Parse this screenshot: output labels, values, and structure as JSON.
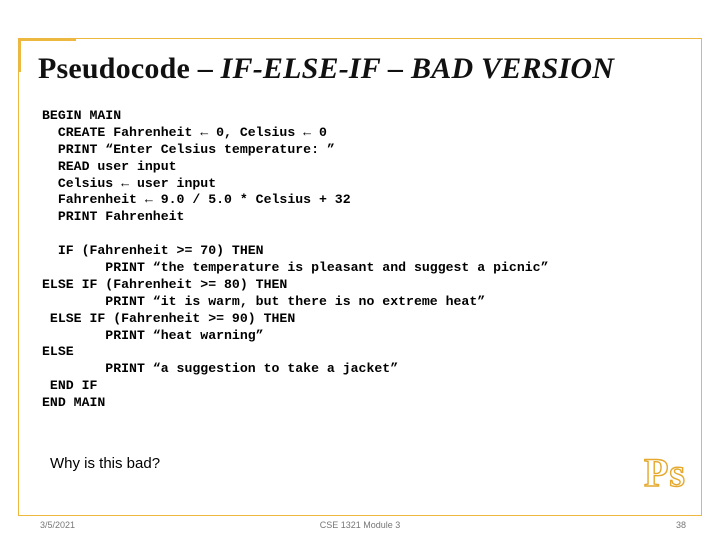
{
  "title": {
    "part1": "Pseudocode – ",
    "emphasis": "IF-ELSE-IF – BAD VERSION"
  },
  "code_lines": [
    "BEGIN MAIN",
    "  CREATE Fahrenheit ← 0, Celsius ← 0",
    "  PRINT “Enter Celsius temperature: ”",
    "  READ user input",
    "  Celsius ← user input",
    "  Fahrenheit ← 9.0 / 5.0 * Celsius + 32",
    "  PRINT Fahrenheit",
    "",
    "  IF (Fahrenheit >= 70) THEN",
    "        PRINT “the temperature is pleasant and suggest a picnic”",
    "ELSE IF (Fahrenheit >= 80) THEN",
    "        PRINT “it is warm, but there is no extreme heat”",
    " ELSE IF (Fahrenheit >= 90) THEN",
    "        PRINT “heat warning”",
    "ELSE",
    "        PRINT “a suggestion to take a jacket”",
    " END IF",
    "END MAIN"
  ],
  "question": "Why is this bad?",
  "ps_label": "Ps",
  "footer": {
    "date": "3/5/2021",
    "center": "CSE 1321 Module 3",
    "page": "38"
  }
}
